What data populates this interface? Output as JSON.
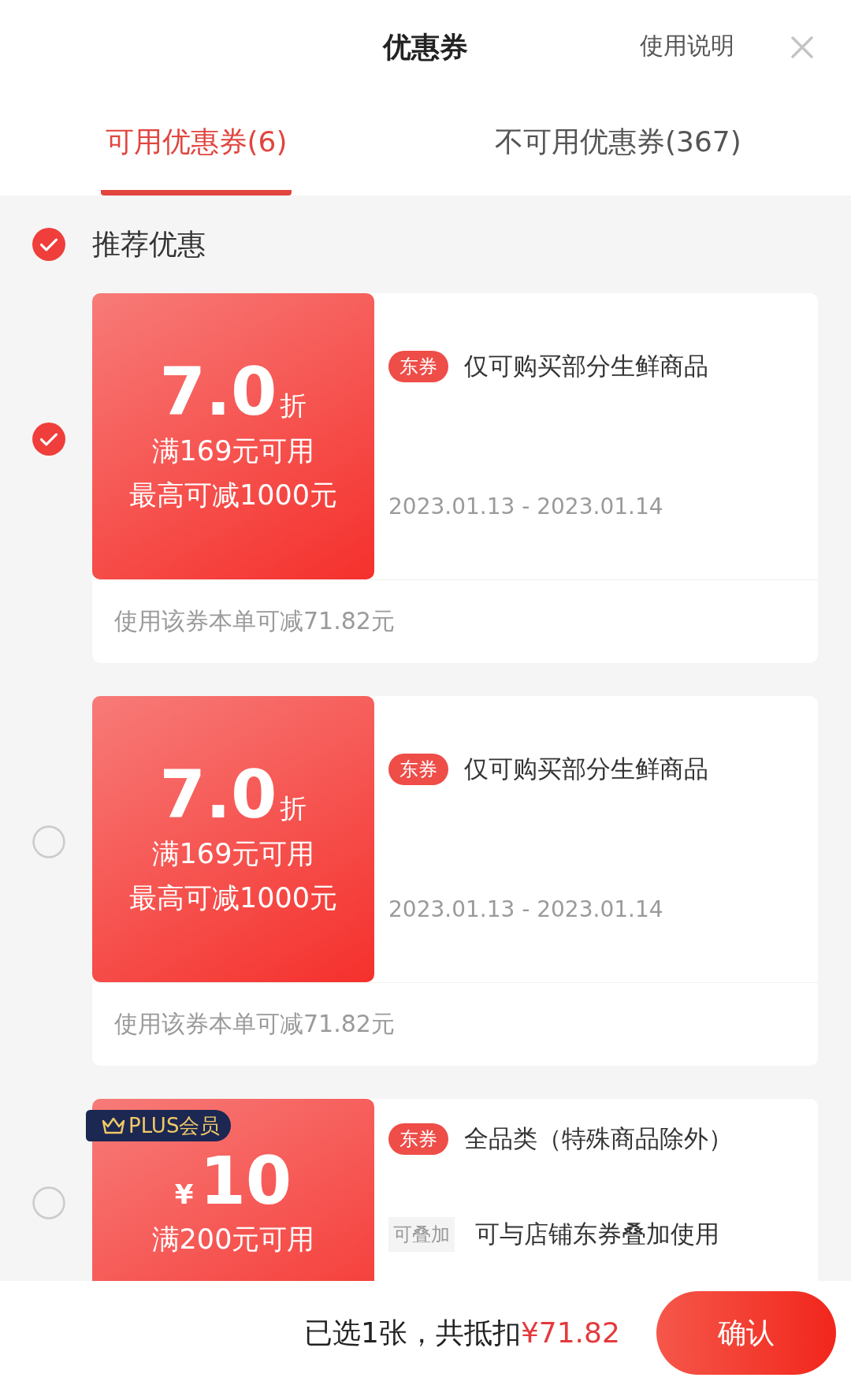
{
  "header": {
    "title": "优惠券",
    "help_link": "使用说明"
  },
  "tabs": [
    {
      "label": "可用优惠券(6)",
      "selected": true
    },
    {
      "label": "不可用优惠券(367)",
      "selected": false
    }
  ],
  "recommend": {
    "label": "推荐优惠",
    "checked": true
  },
  "coupons": [
    {
      "kind": "discount",
      "selected": true,
      "amount": "7.0",
      "unit": "折",
      "condition": "满169元可用",
      "cap": "最高可减1000元",
      "tag": "东券",
      "scope": "仅可购买部分生鲜商品",
      "validity": "2023.01.13 - 2023.01.14",
      "savings": "使用该券本单可减71.82元"
    },
    {
      "kind": "discount",
      "selected": false,
      "amount": "7.0",
      "unit": "折",
      "condition": "满169元可用",
      "cap": "最高可减1000元",
      "tag": "东券",
      "scope": "仅可购买部分生鲜商品",
      "validity": "2023.01.13 - 2023.01.14",
      "savings": "使用该券本单可减71.82元"
    },
    {
      "kind": "cash",
      "selected": false,
      "badge": "PLUS会员",
      "currency": "¥",
      "amount": "10",
      "condition": "满200元可用",
      "tag": "东券",
      "scope": "全品类（特殊商品除外）",
      "note_tag": "可叠加",
      "note": "可与店铺东券叠加使用"
    }
  ],
  "footer": {
    "summary_prefix": "已选1张，共抵扣",
    "summary_amount": "¥71.82",
    "confirm": "确认"
  }
}
